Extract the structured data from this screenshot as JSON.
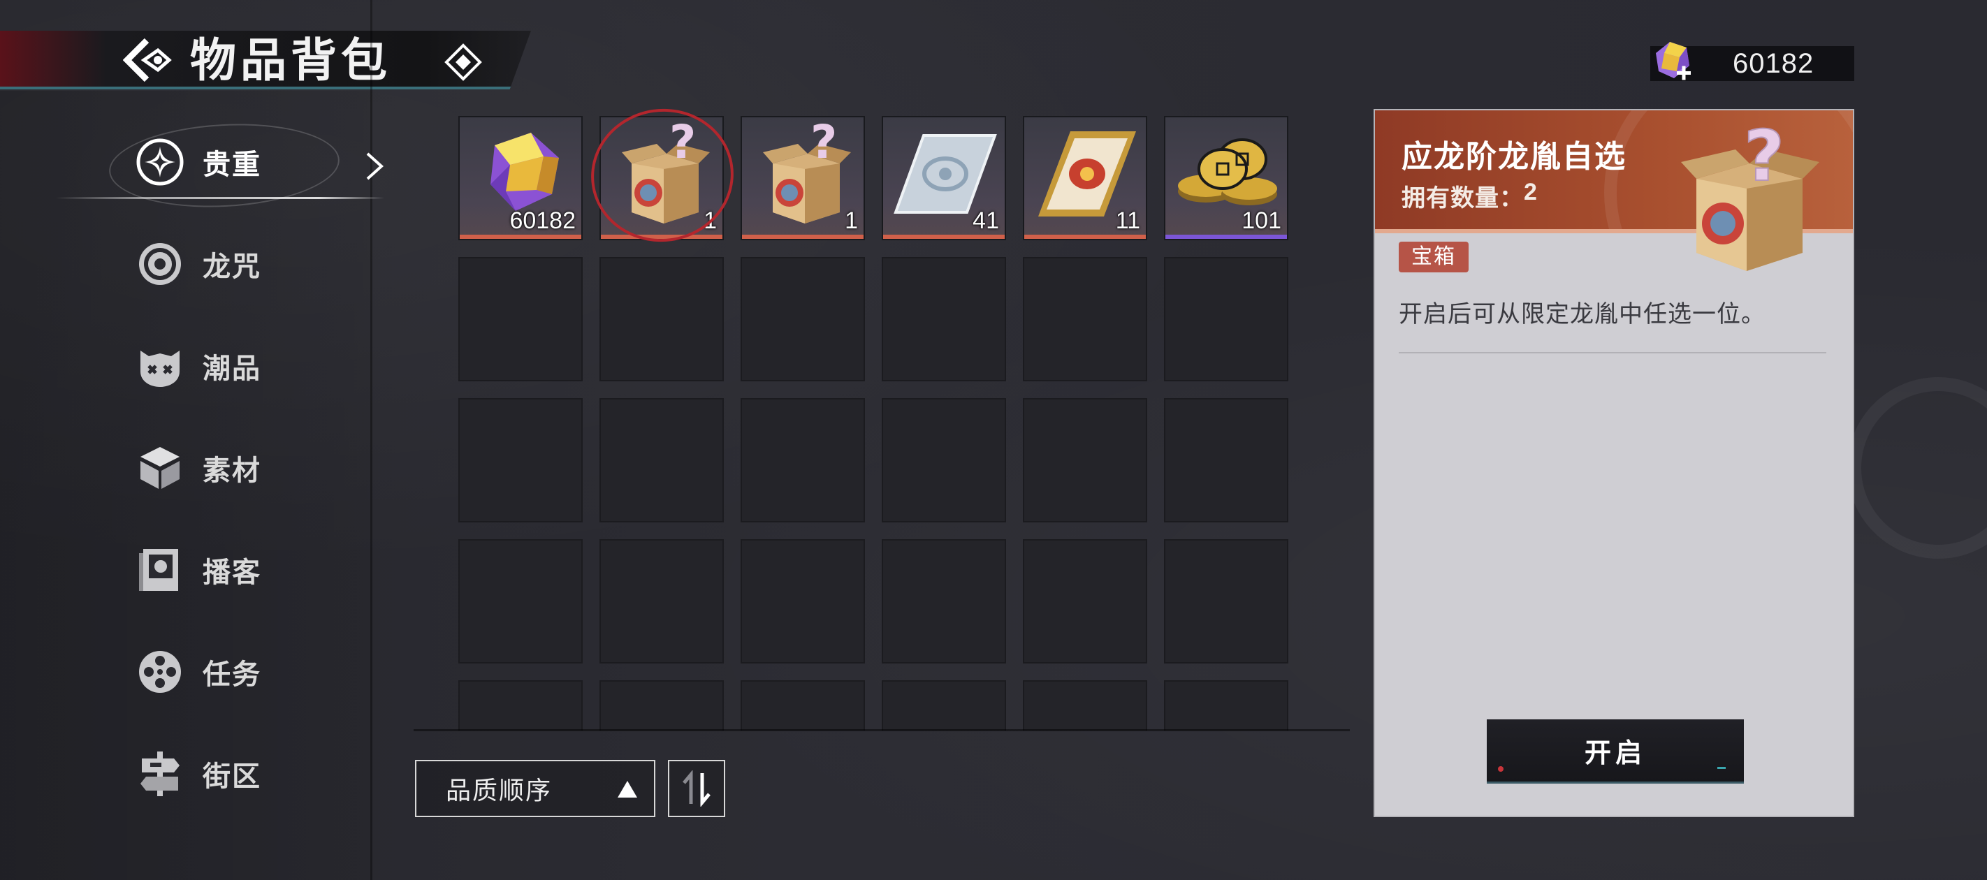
{
  "header": {
    "title": "物品背包"
  },
  "currency": {
    "value": "60182",
    "icon": "gem-plus-icon"
  },
  "sidebar": {
    "items": [
      {
        "label": "贵重",
        "icon": "sparkle-icon",
        "active": true
      },
      {
        "label": "龙咒",
        "icon": "spiral-icon"
      },
      {
        "label": "潮品",
        "icon": "mask-icon"
      },
      {
        "label": "素材",
        "icon": "cube-icon"
      },
      {
        "label": "播客",
        "icon": "photo-card-icon"
      },
      {
        "label": "任务",
        "icon": "film-reel-icon"
      },
      {
        "label": "街区",
        "icon": "street-sign-icon"
      }
    ]
  },
  "inventory": {
    "items": [
      {
        "name": "gem",
        "icon": "purple-gem-icon",
        "qty": "60182",
        "rarity": "orange"
      },
      {
        "name": "mystery-box",
        "icon": "mystery-box-icon",
        "qty": "1",
        "rarity": "orange",
        "selected": true
      },
      {
        "name": "mystery-box",
        "icon": "mystery-box-icon",
        "qty": "1",
        "rarity": "orange"
      },
      {
        "name": "silver-ticket",
        "icon": "silver-ticket-icon",
        "qty": "41",
        "rarity": "orange"
      },
      {
        "name": "gold-ticket",
        "icon": "gold-ticket-icon",
        "qty": "11",
        "rarity": "orange"
      },
      {
        "name": "coins",
        "icon": "gold-coins-icon",
        "qty": "101",
        "rarity": "purple"
      }
    ]
  },
  "sort": {
    "label": "品质顺序"
  },
  "detail": {
    "title": "应龙阶龙胤自选",
    "owned_label": "拥有数量：",
    "owned_count": "2",
    "type_tag": "宝箱",
    "description": "开启后可从限定龙胤中任选一位。",
    "open_button": "开启"
  },
  "colors": {
    "accent_red": "#b3262d",
    "panel_header": "#a9502f",
    "rarity_orange": "#d0604a",
    "rarity_purple": "#7c56d6"
  }
}
